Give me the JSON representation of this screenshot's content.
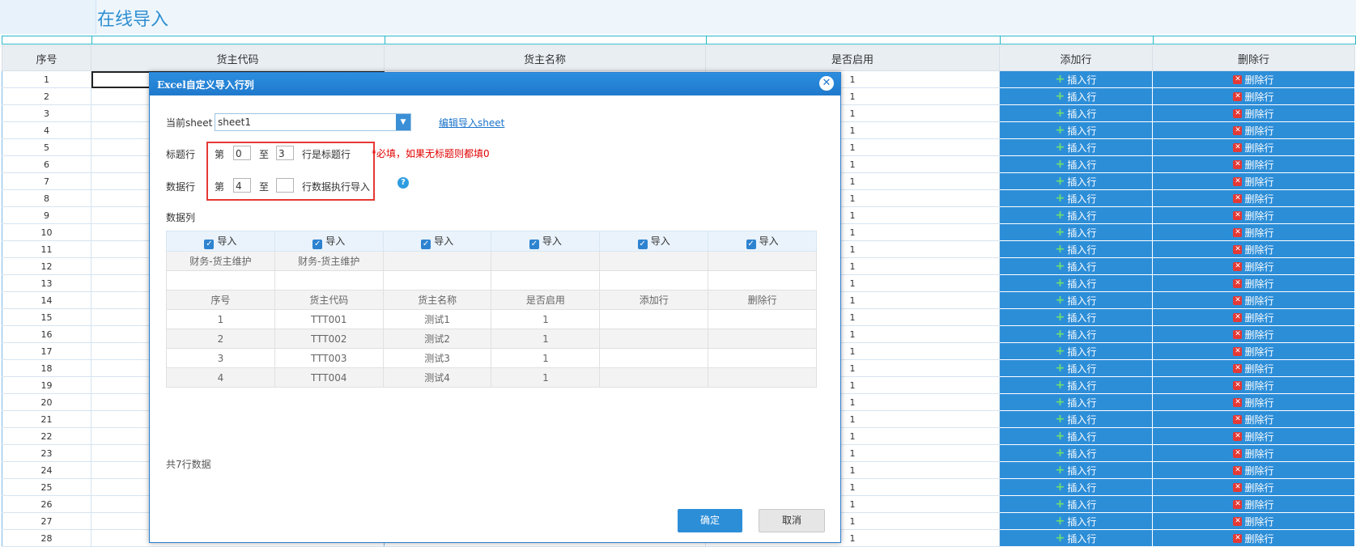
{
  "page": {
    "title": "在线导入"
  },
  "grid": {
    "headers": {
      "seq": "序号",
      "code": "货主代码",
      "name": "货主名称",
      "enabled": "是否启用",
      "add": "添加行",
      "delete": "删除行"
    },
    "rows": [
      {
        "seq": "1",
        "enabled": "1"
      },
      {
        "seq": "2",
        "enabled": "1"
      },
      {
        "seq": "3",
        "enabled": "1"
      },
      {
        "seq": "4",
        "enabled": "1"
      },
      {
        "seq": "5",
        "enabled": "1"
      },
      {
        "seq": "6",
        "enabled": "1"
      },
      {
        "seq": "7",
        "enabled": "1"
      },
      {
        "seq": "8",
        "enabled": "1"
      },
      {
        "seq": "9",
        "enabled": "1"
      },
      {
        "seq": "10",
        "enabled": "1"
      },
      {
        "seq": "11",
        "enabled": "1"
      },
      {
        "seq": "12",
        "enabled": "1"
      },
      {
        "seq": "13",
        "enabled": "1"
      },
      {
        "seq": "14",
        "enabled": "1"
      },
      {
        "seq": "15",
        "enabled": "1"
      },
      {
        "seq": "16",
        "enabled": "1"
      },
      {
        "seq": "17",
        "enabled": "1"
      },
      {
        "seq": "18",
        "enabled": "1"
      },
      {
        "seq": "19",
        "enabled": "1"
      },
      {
        "seq": "20",
        "enabled": "1"
      },
      {
        "seq": "21",
        "enabled": "1"
      },
      {
        "seq": "22",
        "enabled": "1"
      },
      {
        "seq": "23",
        "enabled": "1"
      },
      {
        "seq": "24",
        "enabled": "1"
      },
      {
        "seq": "25",
        "enabled": "1"
      },
      {
        "seq": "26",
        "enabled": "1"
      },
      {
        "seq": "27",
        "enabled": "1"
      },
      {
        "seq": "28",
        "enabled": "1"
      }
    ],
    "insert_label": "插入行",
    "delete_label": "删除行"
  },
  "modal": {
    "title": "Excel自定义导入行列",
    "close_icon": "close-icon",
    "sheet_label": "当前sheet",
    "sheet_value": "sheet1",
    "edit_link": "编辑导入sheet",
    "title_row": {
      "label": "标题行",
      "prefix": "第",
      "from": "0",
      "to_word": "至",
      "to": "3",
      "suffix": "行是标题行",
      "note": "*必填，如果无标题则都填0"
    },
    "data_row": {
      "label": "数据行",
      "prefix": "第",
      "from": "4",
      "to_word": "至",
      "to": "",
      "suffix": "行数据执行导入"
    },
    "data_cols_label": "数据列",
    "import_label": "导入",
    "preview": {
      "row1": [
        "财务-货主维护",
        "财务-货主维护",
        "",
        "",
        "",
        ""
      ],
      "row2": [
        "",
        "",
        "",
        "",
        "",
        ""
      ],
      "header": [
        "序号",
        "货主代码",
        "货主名称",
        "是否启用",
        "添加行",
        "删除行"
      ],
      "rows": [
        [
          "1",
          "TTT001",
          "测试1",
          "1",
          "",
          ""
        ],
        [
          "2",
          "TTT002",
          "测试2",
          "1",
          "",
          ""
        ],
        [
          "3",
          "TTT003",
          "测试3",
          "1",
          "",
          ""
        ],
        [
          "4",
          "TTT004",
          "测试4",
          "1",
          "",
          ""
        ]
      ]
    },
    "total": "共7行数据",
    "ok": "确定",
    "cancel": "取消"
  },
  "colors": {
    "accent": "#2d8ed8",
    "danger": "#e53935",
    "title": "#2f8fd1"
  }
}
